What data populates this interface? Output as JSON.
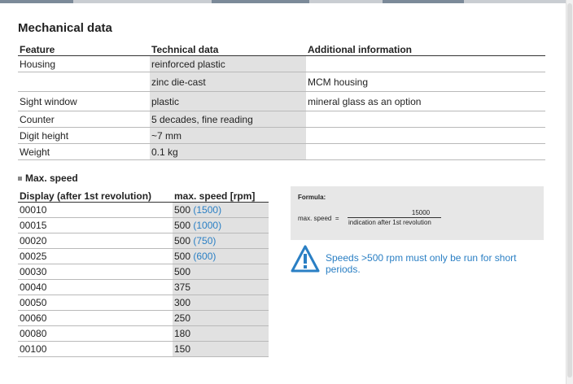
{
  "mechanical": {
    "title": "Mechanical data",
    "headers": [
      "Feature",
      "Technical data",
      "Additional information"
    ],
    "rows": [
      {
        "feature": "Housing",
        "tech": "reinforced plastic",
        "info": ""
      },
      {
        "feature": "",
        "tech": "zinc die-cast",
        "info": "MCM housing"
      },
      {
        "feature": "Sight window",
        "tech": "plastic",
        "info": "mineral glass as an option"
      },
      {
        "feature": "Counter",
        "tech": "5 decades, fine reading",
        "info": ""
      },
      {
        "feature": "Digit height",
        "tech": "~7 mm",
        "info": ""
      },
      {
        "feature": "Weight",
        "tech": "0.1 kg",
        "info": ""
      }
    ]
  },
  "max_speed": {
    "title": "Max. speed",
    "headers": [
      "Display (after 1st revolution)",
      "max. speed [rpm]"
    ],
    "rows": [
      {
        "display": "00010",
        "speed": "500",
        "alt": "(1500)"
      },
      {
        "display": "00015",
        "speed": "500",
        "alt": "(1000)"
      },
      {
        "display": "00020",
        "speed": "500",
        "alt": "(750)"
      },
      {
        "display": "00025",
        "speed": "500",
        "alt": "(600)"
      },
      {
        "display": "00030",
        "speed": "500",
        "alt": ""
      },
      {
        "display": "00040",
        "speed": "375",
        "alt": ""
      },
      {
        "display": "00050",
        "speed": "300",
        "alt": ""
      },
      {
        "display": "00060",
        "speed": "250",
        "alt": ""
      },
      {
        "display": "00080",
        "speed": "180",
        "alt": ""
      },
      {
        "display": "00100",
        "speed": "150",
        "alt": ""
      }
    ]
  },
  "formula": {
    "label": "Formula:",
    "lhs": "max. speed",
    "equals": "=",
    "numerator": "15000",
    "denominator": "indication after 1st revolution"
  },
  "warning": {
    "icon": "warning-triangle-icon",
    "text": "Speeds >500 rpm must only be run for short periods.",
    "color": "#2a7fc4"
  },
  "colors": {
    "accent": "#2a7fc4",
    "cell_shade": "#e1e1e1"
  }
}
